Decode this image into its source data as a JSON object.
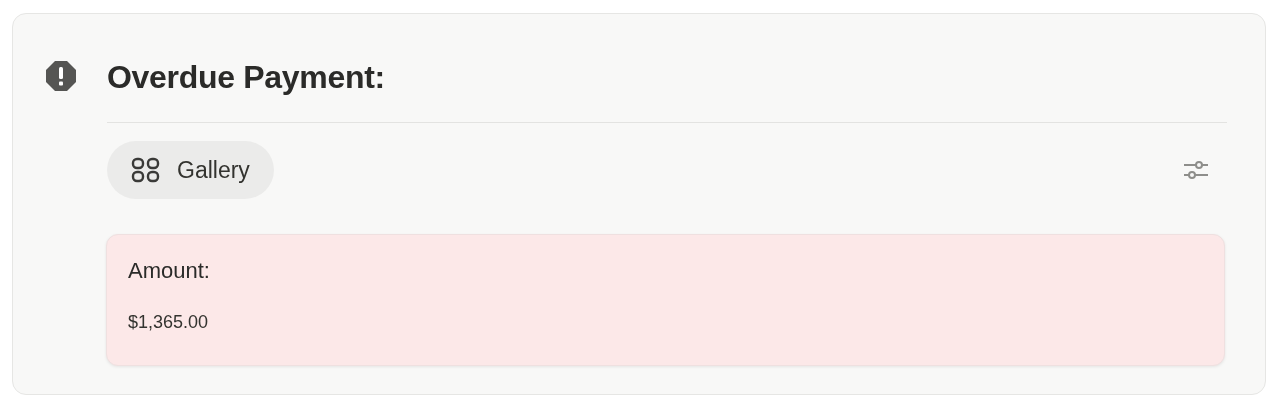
{
  "callout": {
    "title": "Overdue Payment:"
  },
  "views": [
    {
      "label": "Gallery",
      "selected": true
    }
  ],
  "cards": [
    {
      "label": "Amount:",
      "value": "$1,365.00"
    }
  ]
}
